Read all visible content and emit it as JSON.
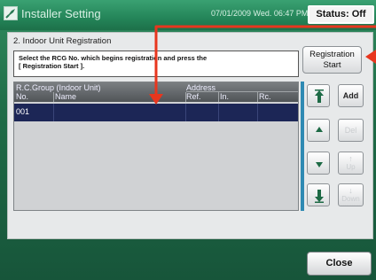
{
  "titlebar": {
    "title": "Installer Setting",
    "datetime": "07/01/2009 Wed. 06:47 PM",
    "status": "Status: Off"
  },
  "panel": {
    "title": "2. Indoor Unit Registration",
    "instruction_line1": "Select the RCG No. which begins registration and press the",
    "instruction_line2": "[ Registration Start ]."
  },
  "table": {
    "header_group": "R.C.Group (Indoor Unit)",
    "header_address": "Address",
    "columns": [
      "No.",
      "Name",
      "Ref.",
      "In.",
      "Rc."
    ],
    "rows": [
      {
        "no": "001",
        "name": "",
        "ref": "",
        "in": "",
        "rc": ""
      }
    ]
  },
  "buttons": {
    "registration_start_line1": "Registration",
    "registration_start_line2": "Start",
    "add": "Add",
    "del": "Del",
    "up": "Up",
    "down": "Down",
    "close": "Close"
  },
  "icons": {
    "title": "installer-setting-icon",
    "page_top": "double-arrow-up-icon",
    "page_up": "arrow-up-icon",
    "page_down": "arrow-down-icon",
    "page_bottom": "double-arrow-down-icon"
  },
  "colors": {
    "annotation_arrow": "#e8361e",
    "selected_row": "#1c2656",
    "background": "#1f6c47"
  }
}
